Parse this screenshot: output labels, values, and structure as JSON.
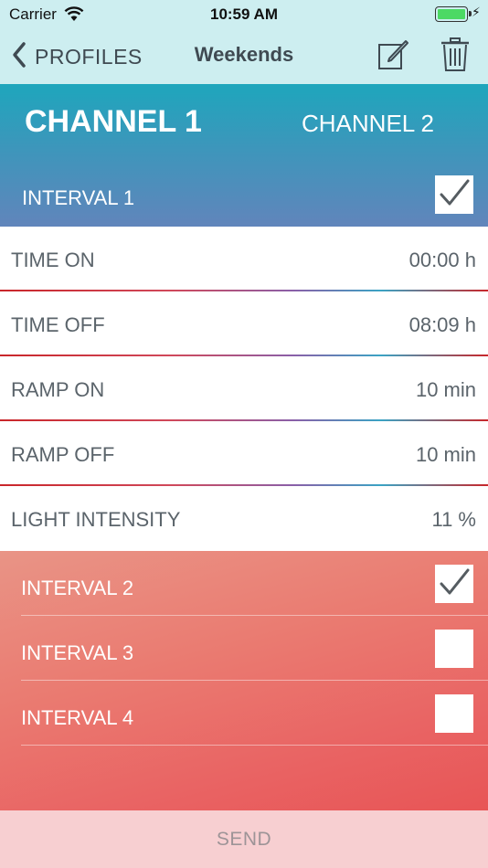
{
  "status_bar": {
    "carrier": "Carrier",
    "time": "10:59 AM"
  },
  "nav": {
    "back_label": "PROFILES",
    "title": "Weekends"
  },
  "channels": {
    "active": "CHANNEL 1",
    "inactive": "CHANNEL 2"
  },
  "interval_1": {
    "label": "INTERVAL 1",
    "checked": true
  },
  "settings": [
    {
      "label": "TIME ON",
      "value": "00:00 h"
    },
    {
      "label": "TIME OFF",
      "value": "08:09 h"
    },
    {
      "label": "RAMP ON",
      "value": "10 min"
    },
    {
      "label": "RAMP OFF",
      "value": "10 min"
    },
    {
      "label": "LIGHT INTENSITY",
      "value": "11 %"
    }
  ],
  "intervals": [
    {
      "label": "INTERVAL 2",
      "checked": true
    },
    {
      "label": "INTERVAL 3",
      "checked": false
    },
    {
      "label": "INTERVAL 4",
      "checked": false
    }
  ],
  "send_label": "SEND",
  "colors": {
    "header_top": "#1ea6bc",
    "header_bottom": "#6185bb",
    "panel_top": "#e99486",
    "panel_bottom": "#e85556",
    "send_bg": "#f7cfd1"
  },
  "icons": [
    "wifi-icon",
    "battery-icon",
    "bolt-icon",
    "chevron-left-icon",
    "edit-icon",
    "trash-icon",
    "checkmark-icon"
  ]
}
